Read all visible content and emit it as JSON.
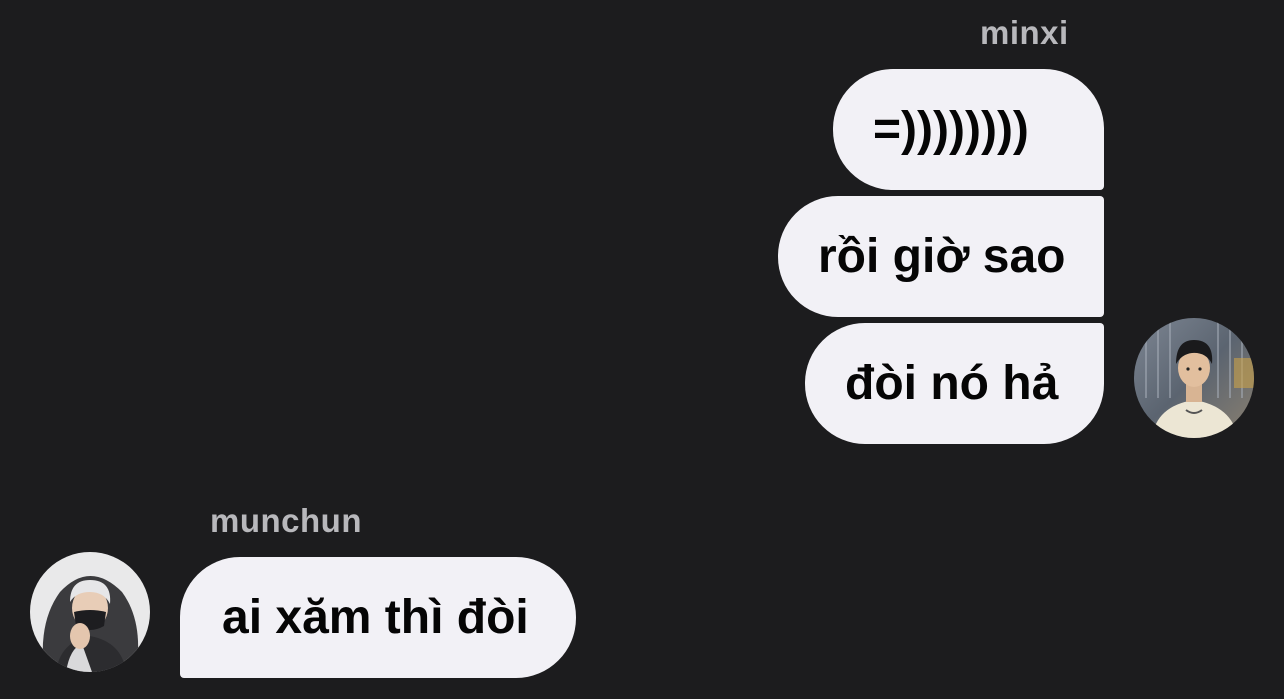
{
  "conversation": {
    "outgoing": {
      "sender": "minxi",
      "messages": [
        "=))))))))",
        "rồi giờ sao",
        "đòi nó hả"
      ]
    },
    "incoming": {
      "sender": "munchun",
      "messages": [
        "ai xăm thì đòi"
      ]
    }
  },
  "avatars": {
    "minxi": {
      "icon": "user-photo-icon"
    },
    "munchun": {
      "icon": "user-photo-icon"
    }
  },
  "colors": {
    "background": "#1c1c1e",
    "bubble": "#f2f1f6",
    "bubble_text": "#050505",
    "sender_name": "#b8b8bc"
  }
}
